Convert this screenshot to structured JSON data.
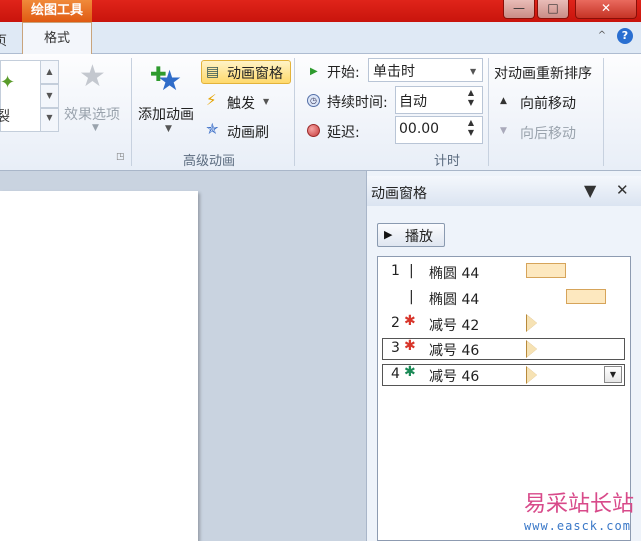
{
  "titlebar": {
    "context_tab": "绘图工具",
    "minimize_glyph": "—",
    "restore_glyph": "□",
    "close_glyph": "✕"
  },
  "tabs": {
    "partial_tab": "页",
    "format_tab": "格式"
  },
  "ribbon_controls": {
    "collapse_glyph": "^",
    "help_glyph": "?"
  },
  "gallery": {
    "partial_label": "裂",
    "up_glyph": "▲",
    "down_glyph": "▼",
    "more_glyph": "▼"
  },
  "effect_options": {
    "label": "效果选项"
  },
  "advanced_animation": {
    "add_animation": "添加动画",
    "animation_pane": "动画窗格",
    "trigger": "触发",
    "animation_painter": "动画刷",
    "group_label": "高级动画"
  },
  "timing": {
    "start_label": "开始:",
    "start_value": "单击时",
    "duration_label": "持续时间:",
    "duration_value": "自动",
    "delay_label": "延迟:",
    "delay_value": "00.00",
    "reorder_header": "对动画重新排序",
    "move_earlier": "向前移动",
    "move_later": "向后移动",
    "group_label": "计时"
  },
  "anim_pane": {
    "title": "动画窗格",
    "play_label": "播放",
    "rows": [
      {
        "num": "1",
        "icon": "|",
        "name": "椭圆 44",
        "timeline": "bar"
      },
      {
        "num": "",
        "icon": "|",
        "name": "椭圆 44",
        "timeline": "bar"
      },
      {
        "num": "2",
        "icon": "✱",
        "name": "减号 42",
        "timeline": "triangle"
      },
      {
        "num": "3",
        "icon": "✱",
        "name": "减号 46",
        "timeline": "triangle"
      },
      {
        "num": "4",
        "icon": "✱",
        "name": "减号 46",
        "timeline": "triangle"
      }
    ]
  },
  "watermark": {
    "main": "易采站长站",
    "url": "www.easck.com"
  },
  "colors": {
    "titlebar_red": "#d41c12",
    "context_orange": "#e8701f",
    "exit_star_red": "#d8352a",
    "emphasis_star_green": "#1a8a56",
    "timeline_bar": "#fde8bf"
  }
}
